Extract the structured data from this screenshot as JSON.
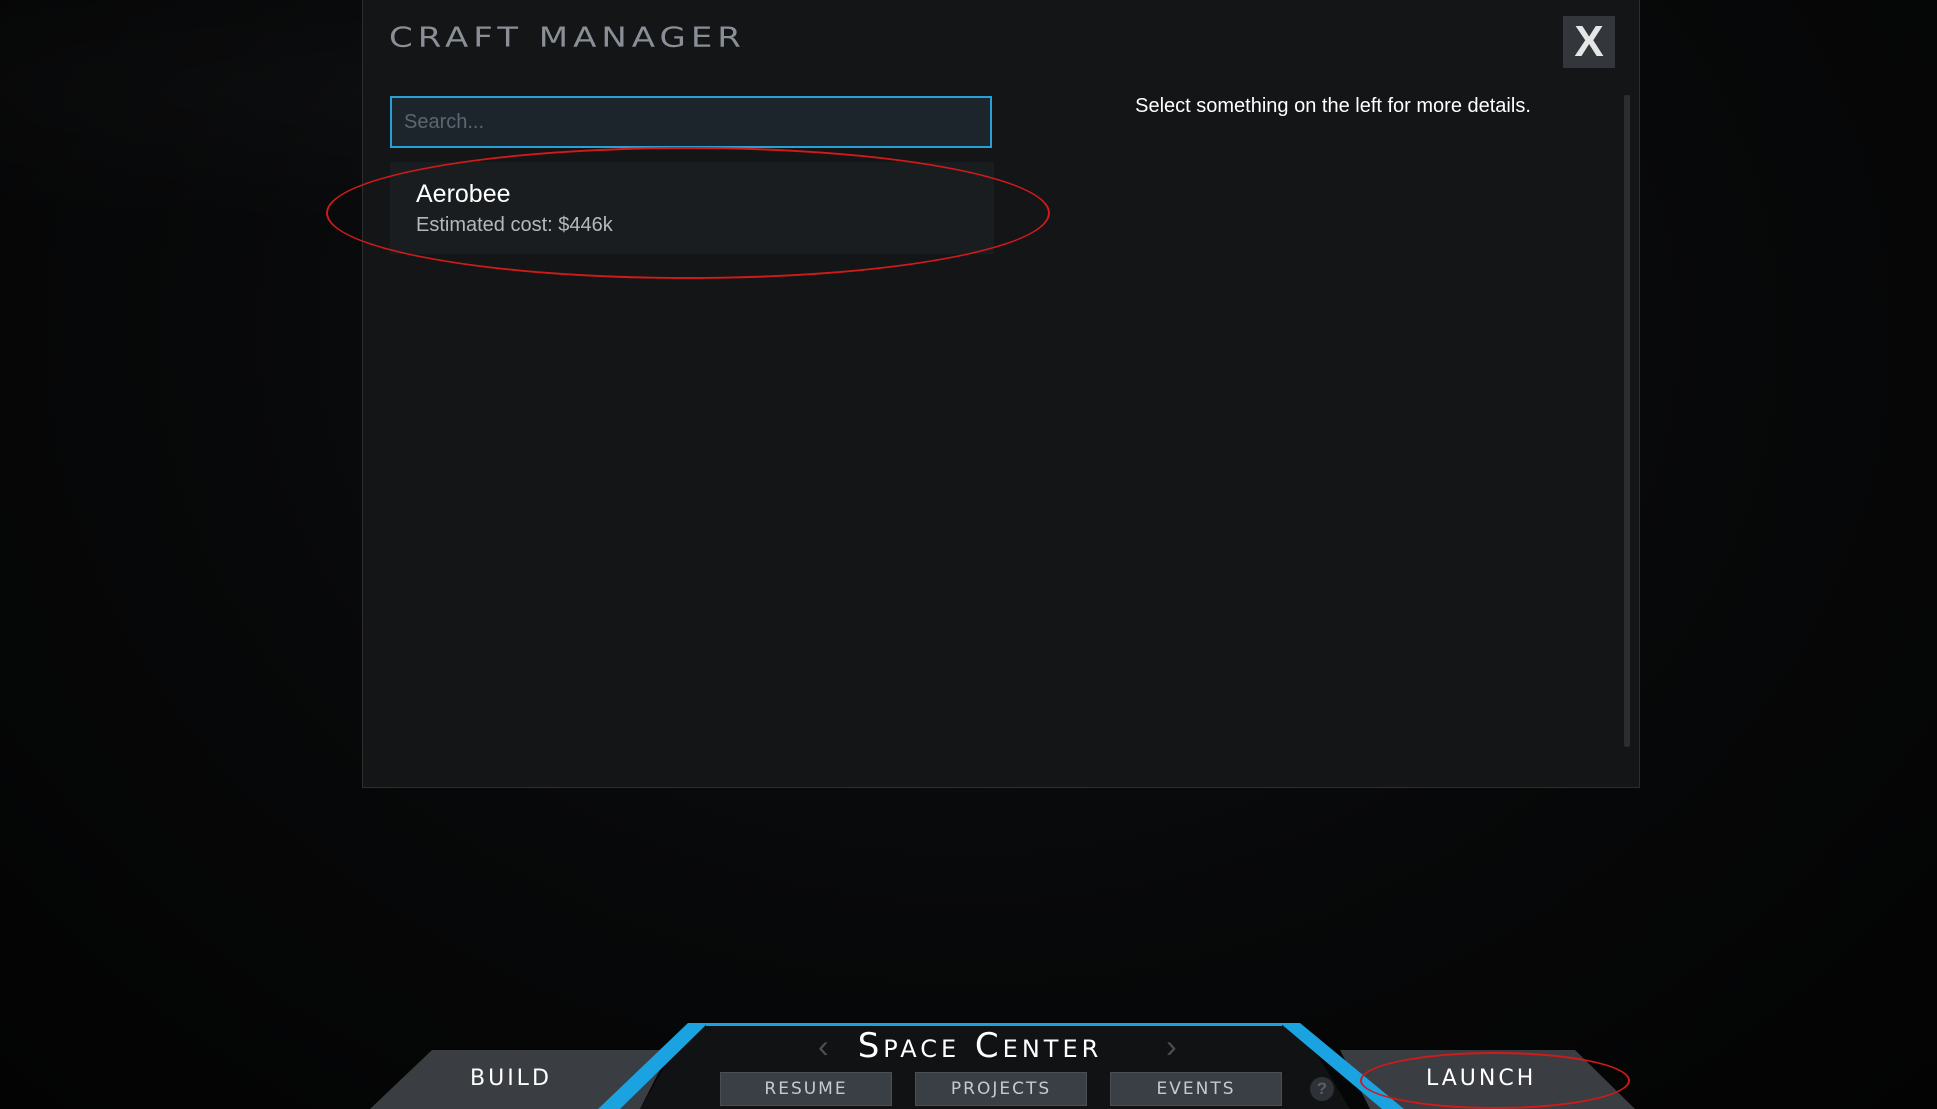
{
  "dialog": {
    "title": "Craft Manager",
    "close_label": "X",
    "search": {
      "placeholder": "Search...",
      "value": ""
    },
    "crafts": [
      {
        "name": "Aerobee",
        "cost": "Estimated cost: $446k"
      }
    ],
    "hint": "Select something on the left for more details."
  },
  "bottom_bar": {
    "title": "Space Center",
    "prev_arrow": "‹",
    "next_arrow": "›",
    "build_label": "Build",
    "launch_label": "Launch",
    "tabs": [
      {
        "label": "Resume"
      },
      {
        "label": "Projects"
      },
      {
        "label": "Events"
      }
    ],
    "help_label": "?"
  },
  "colors": {
    "accent": "#2a9fd6",
    "annotation": "#d11a1a",
    "panel": "#141516"
  },
  "icons": {
    "close": "close-icon",
    "help": "help-icon",
    "prev": "chevron-left-icon",
    "next": "chevron-right-icon"
  }
}
